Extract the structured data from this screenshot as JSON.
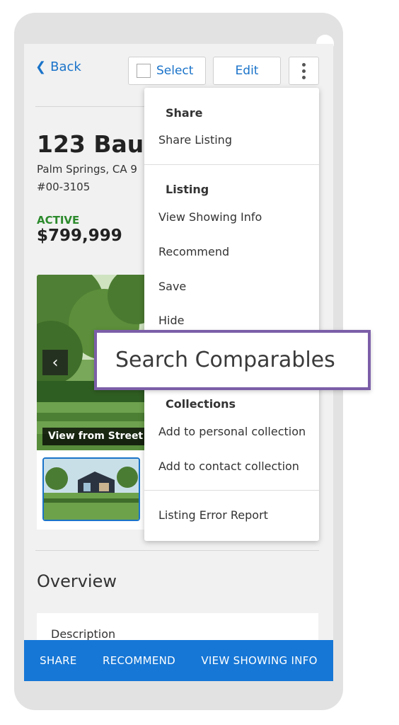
{
  "header": {
    "back_label": "Back",
    "select_label": "Select",
    "edit_label": "Edit"
  },
  "listing": {
    "address": "123 Baun",
    "city": "Palm Springs, CA 9",
    "mls_number": "#00-3105",
    "status": "ACTIVE",
    "price": "$799,999"
  },
  "photos": {
    "caption": "View from Street"
  },
  "overview": {
    "title": "Overview",
    "description_label": "Description"
  },
  "bottom_bar": {
    "share": "SHARE",
    "recommend": "RECOMMEND",
    "view_showing": "VIEW SHOWING INFO"
  },
  "menu": {
    "share_group": "Share",
    "share_listing": "Share Listing",
    "listing_group": "Listing",
    "view_showing_info": "View Showing Info",
    "recommend": "Recommend",
    "save": "Save",
    "hide": "Hide",
    "collections_group": "Collections",
    "add_personal": "Add to personal collection",
    "add_contact": "Add to contact collection",
    "error_report": "Listing Error Report"
  },
  "highlight": {
    "label": "Search Comparables",
    "border_color": "#7b5ea8"
  },
  "colors": {
    "accent": "#1a73c9",
    "bottom_bar": "#1677d6",
    "status": "#2c8a2c"
  }
}
